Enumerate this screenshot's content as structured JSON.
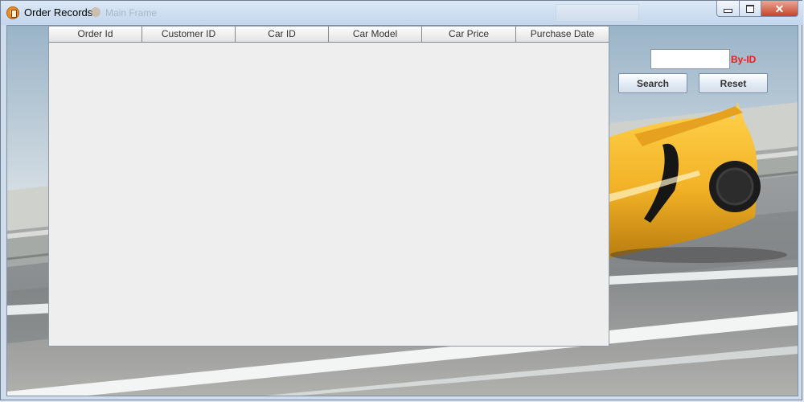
{
  "window": {
    "title": "Order Records",
    "ghost_title": "Main Frame",
    "icon": "order-records-app-icon",
    "controls": {
      "minimize": "minimize-icon",
      "maximize": "maximize-icon",
      "close": "close-icon",
      "close_glyph": "✕"
    }
  },
  "background": {
    "description_icon": "yellow-sports-car-photo"
  },
  "table": {
    "columns": [
      "Order Id",
      "Customer ID",
      "Car ID",
      "Car Model",
      "Car Price",
      "Purchase Date"
    ],
    "rows": []
  },
  "search": {
    "input_value": "",
    "label": "By-ID",
    "search_button": "Search",
    "reset_button": "Reset"
  },
  "colors": {
    "label_red": "#f21b1b",
    "table_bg": "#eeeeee",
    "car_yellow": "#f2b227"
  }
}
